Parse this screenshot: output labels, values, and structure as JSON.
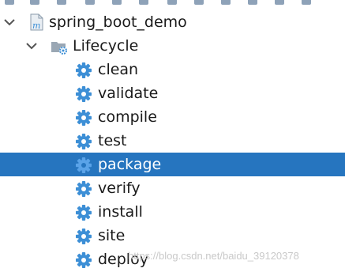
{
  "maven_tree": {
    "project": {
      "name": "spring_boot_demo",
      "icon": "maven-project-icon",
      "expanded": true
    },
    "lifecycle": {
      "label": "Lifecycle",
      "icon": "folder-gear-icon",
      "expanded": true,
      "phases": [
        {
          "label": "clean",
          "icon": "gear-icon",
          "selected": false
        },
        {
          "label": "validate",
          "icon": "gear-icon",
          "selected": false
        },
        {
          "label": "compile",
          "icon": "gear-icon",
          "selected": false
        },
        {
          "label": "test",
          "icon": "gear-icon",
          "selected": false
        },
        {
          "label": "package",
          "icon": "gear-icon",
          "selected": true
        },
        {
          "label": "verify",
          "icon": "gear-icon",
          "selected": false
        },
        {
          "label": "install",
          "icon": "gear-icon",
          "selected": false
        },
        {
          "label": "site",
          "icon": "gear-icon",
          "selected": false
        },
        {
          "label": "deploy",
          "icon": "gear-icon",
          "selected": false
        }
      ]
    }
  },
  "watermark": "https://blog.csdn.net/baidu_39120378",
  "colors": {
    "selection": "#2675bf",
    "gear": "#3d8fd6",
    "folder": "#9aa7b4",
    "watermark": "#c9c9c9"
  }
}
